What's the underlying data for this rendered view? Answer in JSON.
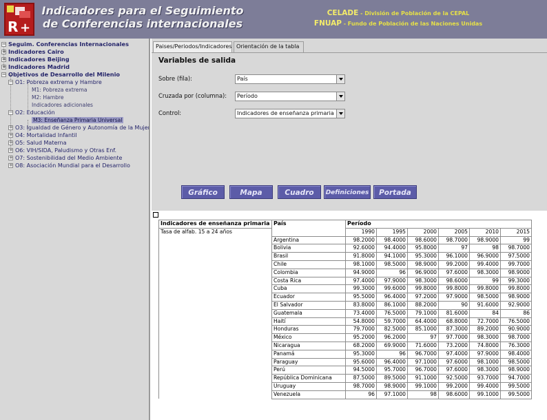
{
  "header": {
    "title_line1": "Indicadores para el Seguimiento",
    "title_line2": "de Conferencias internacionales",
    "org1_abbr": "CELADE",
    "org1_desc": " - División de Población de la CEPAL",
    "org2_abbr": "FNUAP",
    "org2_desc": " - Fundo de Población de las Naciones Unidas"
  },
  "sidebar": {
    "root": "Seguim. Conferencias Internacionales",
    "items": [
      {
        "label": "Indicadores Cairo"
      },
      {
        "label": "Indicadores Beijing"
      },
      {
        "label": "Indicadores Madrid"
      },
      {
        "label": "Objetivos de Desarrollo del Milenio"
      },
      {
        "label": "O1: Pobreza extrema y Hambre"
      },
      {
        "label": "M1: Pobreza extrema"
      },
      {
        "label": "M2: Hambre"
      },
      {
        "label": "Indicadores adicionales"
      },
      {
        "label": "O2: Educación"
      },
      {
        "label": "M3: Enseñanza Primaria Universal"
      },
      {
        "label": "O3: Igualdad de Género y Autonomía de la Mujer"
      },
      {
        "label": "O4: Mortalidad Infantil"
      },
      {
        "label": "O5: Salud Materna"
      },
      {
        "label": "O6: VIH/SIDA, Paludismo y Otras Enf."
      },
      {
        "label": "O7: Sostenibilidad del Medio Ambiente"
      },
      {
        "label": "O8: Asociación Mundial para el Desarrollo"
      }
    ]
  },
  "tabs": [
    "Paises/Periodos/Indicadores",
    "Orientación de la tabla"
  ],
  "variables": {
    "title": "Variables de salida",
    "row_label": "Sobre (fila):",
    "row_value": "País",
    "col_label": "Cruzada por (columna):",
    "col_value": "Período",
    "control_label": "Control:",
    "control_value": "Indicadores de enseñanza primaria"
  },
  "buttons": [
    "Gráfico",
    "Mapa",
    "Cuadro",
    "Definiciones",
    "Portada"
  ],
  "table": {
    "indicator_header": "Indicadores de enseñanza primaria",
    "country_header": "País",
    "period_header": "Período",
    "indicator_name": "Tasa de alfab. 15 a 24 años",
    "years": [
      "1990",
      "1995",
      "2000",
      "2005",
      "2010",
      "2015"
    ],
    "rows": [
      {
        "country": "Argentina",
        "values": [
          "98.2000",
          "98.4000",
          "98.6000",
          "98.7000",
          "98.9000",
          "99"
        ]
      },
      {
        "country": "Bolivia",
        "values": [
          "92.6000",
          "94.4000",
          "95.8000",
          "97",
          "98",
          "98.7000"
        ]
      },
      {
        "country": "Brasil",
        "values": [
          "91.8000",
          "94.1000",
          "95.3000",
          "96.1000",
          "96.9000",
          "97.5000"
        ]
      },
      {
        "country": "Chile",
        "values": [
          "98.1000",
          "98.5000",
          "98.9000",
          "99.2000",
          "99.4000",
          "99.7000"
        ]
      },
      {
        "country": "Colombia",
        "values": [
          "94.9000",
          "96",
          "96.9000",
          "97.6000",
          "98.3000",
          "98.9000"
        ]
      },
      {
        "country": "Costa Rica",
        "values": [
          "97.4000",
          "97.9000",
          "98.3000",
          "98.6000",
          "99",
          "99.3000"
        ]
      },
      {
        "country": "Cuba",
        "values": [
          "99.3000",
          "99.6000",
          "99.8000",
          "99.8000",
          "99.8000",
          "99.8000"
        ]
      },
      {
        "country": "Ecuador",
        "values": [
          "95.5000",
          "96.4000",
          "97.2000",
          "97.9000",
          "98.5000",
          "98.9000"
        ]
      },
      {
        "country": "El Salvador",
        "values": [
          "83.8000",
          "86.1000",
          "88.2000",
          "90",
          "91.6000",
          "92.9000"
        ]
      },
      {
        "country": "Guatemala",
        "values": [
          "73.4000",
          "76.5000",
          "79.1000",
          "81.6000",
          "84",
          "86"
        ]
      },
      {
        "country": "Haití",
        "values": [
          "54.8000",
          "59.7000",
          "64.4000",
          "68.8000",
          "72.7000",
          "76.5000"
        ]
      },
      {
        "country": "Honduras",
        "values": [
          "79.7000",
          "82.5000",
          "85.1000",
          "87.3000",
          "89.2000",
          "90.9000"
        ]
      },
      {
        "country": "México",
        "values": [
          "95.2000",
          "96.2000",
          "97",
          "97.7000",
          "98.3000",
          "98.7000"
        ]
      },
      {
        "country": "Nicaragua",
        "values": [
          "68.2000",
          "69.9000",
          "71.6000",
          "73.2000",
          "74.8000",
          "76.3000"
        ]
      },
      {
        "country": "Panamá",
        "values": [
          "95.3000",
          "96",
          "96.7000",
          "97.4000",
          "97.9000",
          "98.4000"
        ]
      },
      {
        "country": "Paraguay",
        "values": [
          "95.6000",
          "96.4000",
          "97.1000",
          "97.6000",
          "98.1000",
          "98.5000"
        ]
      },
      {
        "country": "Perú",
        "values": [
          "94.5000",
          "95.7000",
          "96.7000",
          "97.6000",
          "98.3000",
          "98.9000"
        ]
      },
      {
        "country": "República Dominicana",
        "values": [
          "87.5000",
          "89.5000",
          "91.1000",
          "92.5000",
          "93.7000",
          "94.7000"
        ]
      },
      {
        "country": "Uruguay",
        "values": [
          "98.7000",
          "98.9000",
          "99.1000",
          "99.2000",
          "99.4000",
          "99.5000"
        ]
      },
      {
        "country": "Venezuela",
        "values": [
          "96",
          "97.1000",
          "98",
          "98.6000",
          "99.1000",
          "99.5000"
        ]
      }
    ]
  }
}
